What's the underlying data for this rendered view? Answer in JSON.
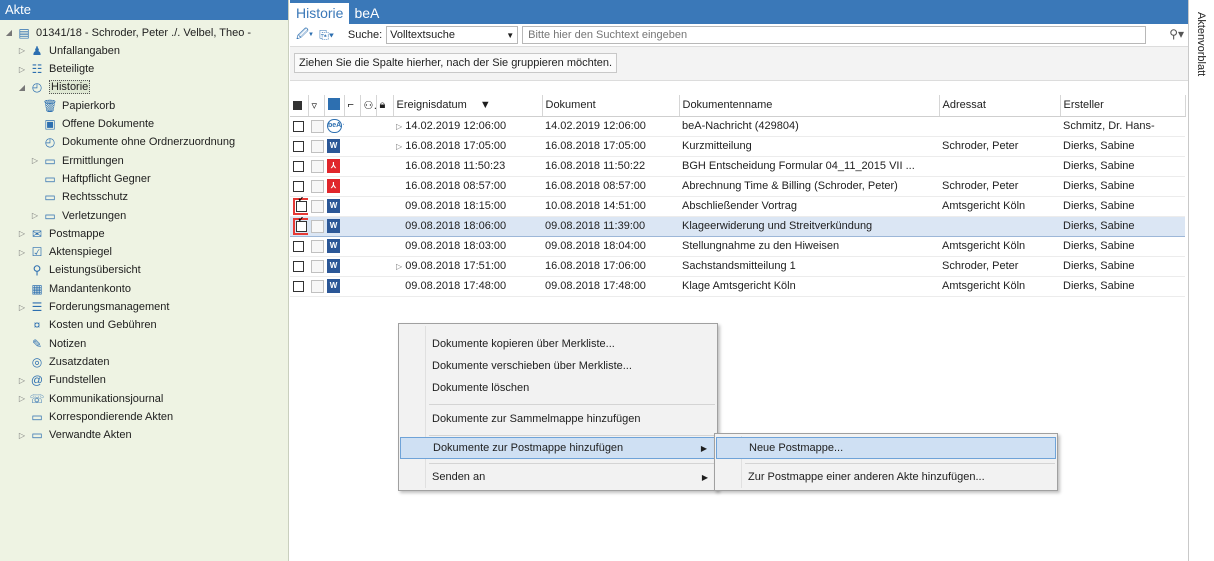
{
  "left": {
    "header": "Akte",
    "tree": [
      {
        "label": "01341/18 - Schroder, Peter ./. Velbel, Theo -",
        "icon": "case-icon",
        "arrow": "◢",
        "indent": 0
      },
      {
        "label": "Unfallangaben",
        "icon": "person-icon",
        "arrow": "▷",
        "indent": 1
      },
      {
        "label": "Beteiligte",
        "icon": "people-icon",
        "arrow": "▷",
        "indent": 1
      },
      {
        "label": "Historie",
        "icon": "clock-icon",
        "arrow": "◢",
        "indent": 1
      },
      {
        "label": "Papierkorb",
        "icon": "trash-icon",
        "arrow": "",
        "indent": 2
      },
      {
        "label": "Offene Dokumente",
        "icon": "open-doc-icon",
        "arrow": "",
        "indent": 2
      },
      {
        "label": "Dokumente ohne Ordnerzuordnung",
        "icon": "clock-icon",
        "arrow": "",
        "indent": 2
      },
      {
        "label": "Ermittlungen",
        "icon": "folder-icon",
        "arrow": "▷",
        "indent": 2
      },
      {
        "label": "Haftpflicht Gegner",
        "icon": "folder-icon",
        "arrow": "",
        "indent": 2
      },
      {
        "label": "Rechtsschutz",
        "icon": "folder-icon",
        "arrow": "",
        "indent": 2
      },
      {
        "label": "Verletzungen",
        "icon": "folder-icon",
        "arrow": "▷",
        "indent": 2
      },
      {
        "label": "Postmappe",
        "icon": "mailbox-icon",
        "arrow": "▷",
        "indent": 1
      },
      {
        "label": "Aktenspiegel",
        "icon": "document-check-icon",
        "arrow": "▷",
        "indent": 1
      },
      {
        "label": "Leistungsübersicht",
        "icon": "service-icon",
        "arrow": "",
        "indent": 1
      },
      {
        "label": "Mandantenkonto",
        "icon": "account-icon",
        "arrow": "",
        "indent": 1
      },
      {
        "label": "Forderungsmanagement",
        "icon": "claims-icon",
        "arrow": "▷",
        "indent": 1
      },
      {
        "label": "Kosten und Gebühren",
        "icon": "money-icon",
        "arrow": "",
        "indent": 1
      },
      {
        "label": "Notizen",
        "icon": "note-icon",
        "arrow": "",
        "indent": 1
      },
      {
        "label": "Zusatzdaten",
        "icon": "data-icon",
        "arrow": "",
        "indent": 1
      },
      {
        "label": "Fundstellen",
        "icon": "at-icon",
        "arrow": "▷",
        "indent": 1
      },
      {
        "label": "Kommunikationsjournal",
        "icon": "communication-icon",
        "arrow": "▷",
        "indent": 1
      },
      {
        "label": "Korrespondierende Akten",
        "icon": "folder-icon",
        "arrow": "",
        "indent": 1
      },
      {
        "label": "Verwandte Akten",
        "icon": "folder-icon",
        "arrow": "▷",
        "indent": 1
      }
    ],
    "selected_index": 3
  },
  "tabs": [
    "Historie",
    "beA"
  ],
  "toolbar": {
    "search_label": "Suche:",
    "search_mode": "Volltextsuche",
    "search_placeholder": "Bitte hier den Suchtext eingeben"
  },
  "group_hint": "Ziehen Sie die Spalte hierher, nach der Sie gruppieren möchten.",
  "side_tab": "Aktenvorblatt",
  "grid": {
    "columns": {
      "ereignisdatum": "Ereignisdatum",
      "dokument": "Dokument",
      "dokumentenname": "Dokumentenname",
      "adressat": "Adressat",
      "ersteller": "Ersteller"
    },
    "rows": [
      {
        "checked": false,
        "type": "bea",
        "expand": true,
        "ereignisdatum": "14.02.2019 12:06:00",
        "dokument": "14.02.2019 12:06:00",
        "name": "beA-Nachricht (429804)",
        "adressat": "",
        "ersteller": "Schmitz, Dr. Hans-"
      },
      {
        "checked": false,
        "type": "word",
        "expand": true,
        "ereignisdatum": "16.08.2018 17:05:00",
        "dokument": "16.08.2018 17:05:00",
        "name": "Kurzmitteilung",
        "adressat": "Schroder, Peter",
        "ersteller": "Dierks, Sabine"
      },
      {
        "checked": false,
        "type": "pdf",
        "expand": false,
        "ereignisdatum": "16.08.2018 11:50:23",
        "dokument": "16.08.2018 11:50:22",
        "name": "BGH Entscheidung Formular 04_11_2015 VII ...",
        "adressat": "",
        "ersteller": "Dierks, Sabine"
      },
      {
        "checked": false,
        "type": "pdf",
        "expand": false,
        "ereignisdatum": "16.08.2018 08:57:00",
        "dokument": "16.08.2018 08:57:00",
        "name": "Abrechnung Time & Billing (Schroder, Peter)",
        "adressat": "Schroder, Peter",
        "ersteller": "Dierks, Sabine"
      },
      {
        "checked": true,
        "type": "word",
        "expand": false,
        "ereignisdatum": "09.08.2018 18:15:00",
        "dokument": "10.08.2018 14:51:00",
        "name": "Abschließender Vortrag",
        "adressat": "Amtsgericht Köln",
        "ersteller": "Dierks, Sabine"
      },
      {
        "checked": true,
        "type": "word",
        "expand": false,
        "ereignisdatum": "09.08.2018 18:06:00",
        "dokument": "09.08.2018 11:39:00",
        "name": "Klageerwiderung und Streitverkündung",
        "adressat": "",
        "ersteller": "Dierks, Sabine"
      },
      {
        "checked": false,
        "type": "word",
        "expand": false,
        "ereignisdatum": "09.08.2018 18:03:00",
        "dokument": "09.08.2018 18:04:00",
        "name": "Stellungnahme zu den Hiweisen",
        "adressat": "Amtsgericht Köln",
        "ersteller": "Dierks, Sabine"
      },
      {
        "checked": false,
        "type": "word",
        "expand": true,
        "ereignisdatum": "09.08.2018 17:51:00",
        "dokument": "16.08.2018 17:06:00",
        "name": "Sachstandsmitteilung 1",
        "adressat": "Schroder, Peter",
        "ersteller": "Dierks, Sabine"
      },
      {
        "checked": false,
        "type": "word",
        "expand": false,
        "ereignisdatum": "09.08.2018 17:48:00",
        "dokument": "09.08.2018 17:48:00",
        "name": "Klage Amtsgericht Köln",
        "adressat": "Amtsgericht Köln",
        "ersteller": "Dierks, Sabine"
      }
    ],
    "highlighted_index": 5
  },
  "context_menu": {
    "items": [
      "Dokumente kopieren über Merkliste...",
      "Dokumente verschieben über Merkliste...",
      "Dokumente löschen",
      "Dokumente zur Sammelmappe hinzufügen",
      "Dokumente zur Postmappe hinzufügen",
      "Senden an"
    ],
    "submenu": [
      "Neue Postmappe...",
      "Zur Postmappe einer anderen Akte hinzufügen..."
    ]
  }
}
